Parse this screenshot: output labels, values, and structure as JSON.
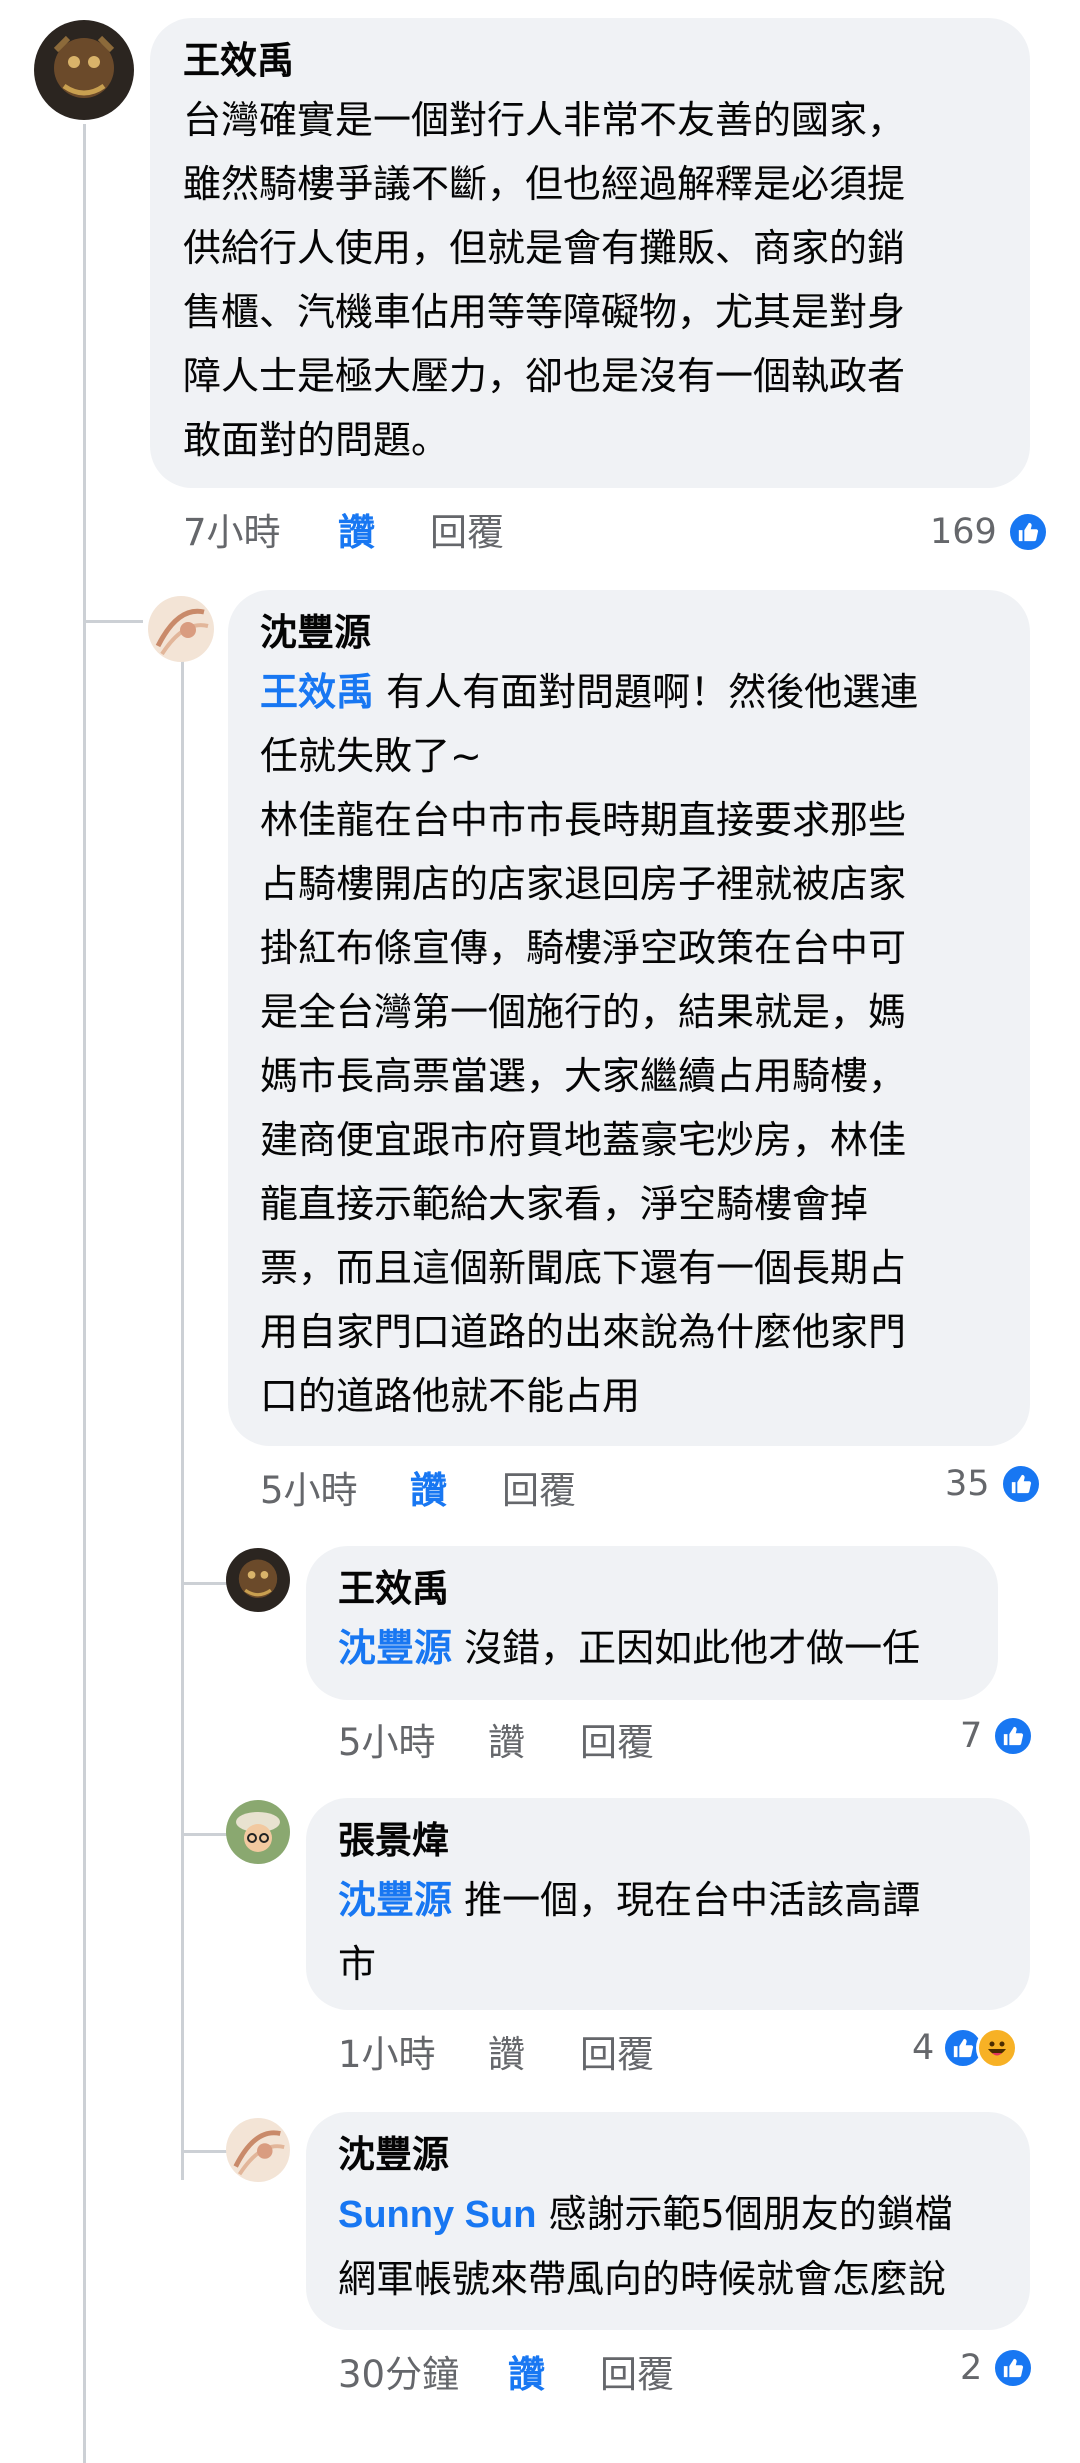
{
  "comments": [
    {
      "author": "王效禹",
      "lines": [
        "台灣確實是一個對行人非常不友善的國家，",
        "雖然騎樓爭議不斷，但也經過解釋是必須提",
        "供給行人使用，但就是會有攤販、商家的銷",
        "售櫃、汽機車佔用等等障礙物，尤其是對身",
        "障人士是極大壓力，卻也是沒有一個執政者",
        "敢面對的問題。"
      ],
      "time": "7小時",
      "like": "讚",
      "reply": "回覆",
      "count": "169"
    },
    {
      "author": "沈豐源",
      "mention": "王效禹",
      "lines": [
        " 有人有面對問題啊！然後他選連",
        "任就失敗了~",
        "林佳龍在台中市市長時期直接要求那些",
        "占騎樓開店的店家退回房子裡就被店家",
        "掛紅布條宣傳，騎樓淨空政策在台中可",
        "是全台灣第一個施行的，結果就是，媽",
        "媽市長高票當選，大家繼續占用騎樓，",
        "建商便宜跟市府買地蓋豪宅炒房，林佳",
        "龍直接示範給大家看，淨空騎樓會掉",
        "票，而且這個新聞底下還有一個長期占",
        "用自家門口道路的出來說為什麼他家門",
        "口的道路他就不能占用"
      ],
      "time": "5小時",
      "like": "讚",
      "reply": "回覆",
      "count": "35"
    },
    {
      "author": "王效禹",
      "mention": "沈豐源",
      "lines": [
        " 沒錯，正因如此他才做一任"
      ],
      "time": "5小時",
      "like": "讚",
      "reply": "回覆",
      "count": "7"
    },
    {
      "author": "張景煒",
      "mention": "沈豐源",
      "lines": [
        " 推一個，現在台中活該高譚",
        "市"
      ],
      "time": "1小時",
      "like": "讚",
      "reply": "回覆",
      "count": "4"
    },
    {
      "author": "沈豐源",
      "mention": "Sunny Sun",
      "lines": [
        " 感謝示範5個朋友的鎖檔",
        "網軍帳號來帶風向的時候就會怎麼說"
      ],
      "time": "30分鐘",
      "like": "讚",
      "reply": "回覆",
      "count": "2"
    }
  ],
  "colors": {
    "accent": "#1877f2",
    "bubble": "#f0f2f5",
    "meta": "#65676b"
  },
  "icons": [
    "like-icon",
    "haha-icon",
    "avatar"
  ]
}
